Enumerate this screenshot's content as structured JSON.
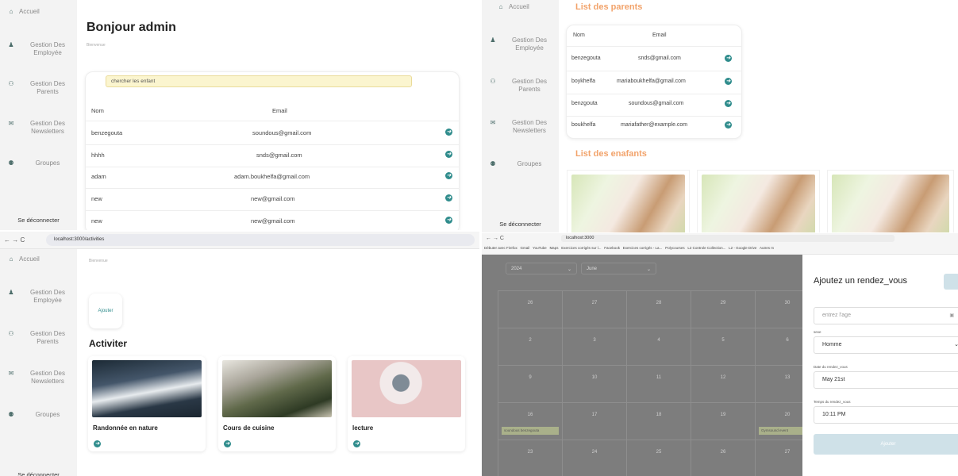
{
  "sidebar": {
    "items": [
      {
        "label": "Accueil",
        "icon": "home-icon"
      },
      {
        "label": "Gestion Des Employée",
        "icon": "person-icon"
      },
      {
        "label": "Gestion Des Parents",
        "icon": "family-icon"
      },
      {
        "label": "Gestion Des Newsletters",
        "icon": "mail-icon"
      },
      {
        "label": "Groupes",
        "icon": "group-icon"
      }
    ],
    "logout": "Se déconnecter"
  },
  "pane1": {
    "title": "Bonjour admin",
    "subtitle": "Bienvenue",
    "search_placeholder": "chercher les enfant",
    "columns": [
      "Nom",
      "Email"
    ],
    "rows": [
      {
        "name": "benzegouta",
        "email": "soundous@gmail.com"
      },
      {
        "name": "hhhh",
        "email": "snds@gmail.com"
      },
      {
        "name": "adam",
        "email": "adam.boukhelfa@gmail.com"
      },
      {
        "name": "new",
        "email": "new@gmail.com"
      },
      {
        "name": "new",
        "email": "new@gmail.com"
      }
    ]
  },
  "pane2": {
    "parents_title": "List des parents",
    "columns": [
      "Nom",
      "Email"
    ],
    "rows": [
      {
        "name": "benzegouta",
        "email": "snds@gmail.com"
      },
      {
        "name": "boykhelfa",
        "email": "mariaboukhelfa@gmail.com"
      },
      {
        "name": "benzgouta",
        "email": "soundous@gmail.com"
      },
      {
        "name": "boukhelfa",
        "email": "mariafather@example.com"
      }
    ],
    "children_title": "List des enafants"
  },
  "pane3": {
    "url": "localhost:3000/activities",
    "subtitle": "Bienvenue",
    "add_label": "Ajouter",
    "section_title": "Activiter",
    "activities": [
      {
        "title": "Randonnée en nature"
      },
      {
        "title": "Cours de cuisine"
      },
      {
        "title": "lecture"
      }
    ]
  },
  "pane4": {
    "url": "localhost:3000",
    "bookmarks": [
      "Débuter avec Firefox",
      "Gmail",
      "YouTube",
      "Maps",
      "Exercices corrigés sur l...",
      "Facebook",
      "Exercices corrigés - La...",
      "Polycourses",
      "L2 Controle Collection...",
      "L2 - Google Drive",
      "Autres m"
    ],
    "year": "2024",
    "month": "June",
    "weeks": [
      [
        "26",
        "27",
        "28",
        "29",
        "30"
      ],
      [
        "2",
        "3",
        "4",
        "5",
        "6"
      ],
      [
        "9",
        "10",
        "11",
        "12",
        "13"
      ],
      [
        "16",
        "17",
        "18",
        "19",
        "20"
      ],
      [
        "23",
        "24",
        "25",
        "26",
        "27"
      ]
    ],
    "events": [
      "soundous benzegouta",
      "Gymsound event"
    ],
    "modal": {
      "title": "Ajoutez un rendez_vous",
      "age_placeholder": "entrez l'age",
      "sexe_label": "sexe",
      "sexe_value": "Homme",
      "date_label": "Date du rendez_vous",
      "date_value": "May 21st",
      "time_label": "Temps du rendez_vous",
      "time_value": "10:11 PM",
      "submit": "Ajouter"
    }
  }
}
